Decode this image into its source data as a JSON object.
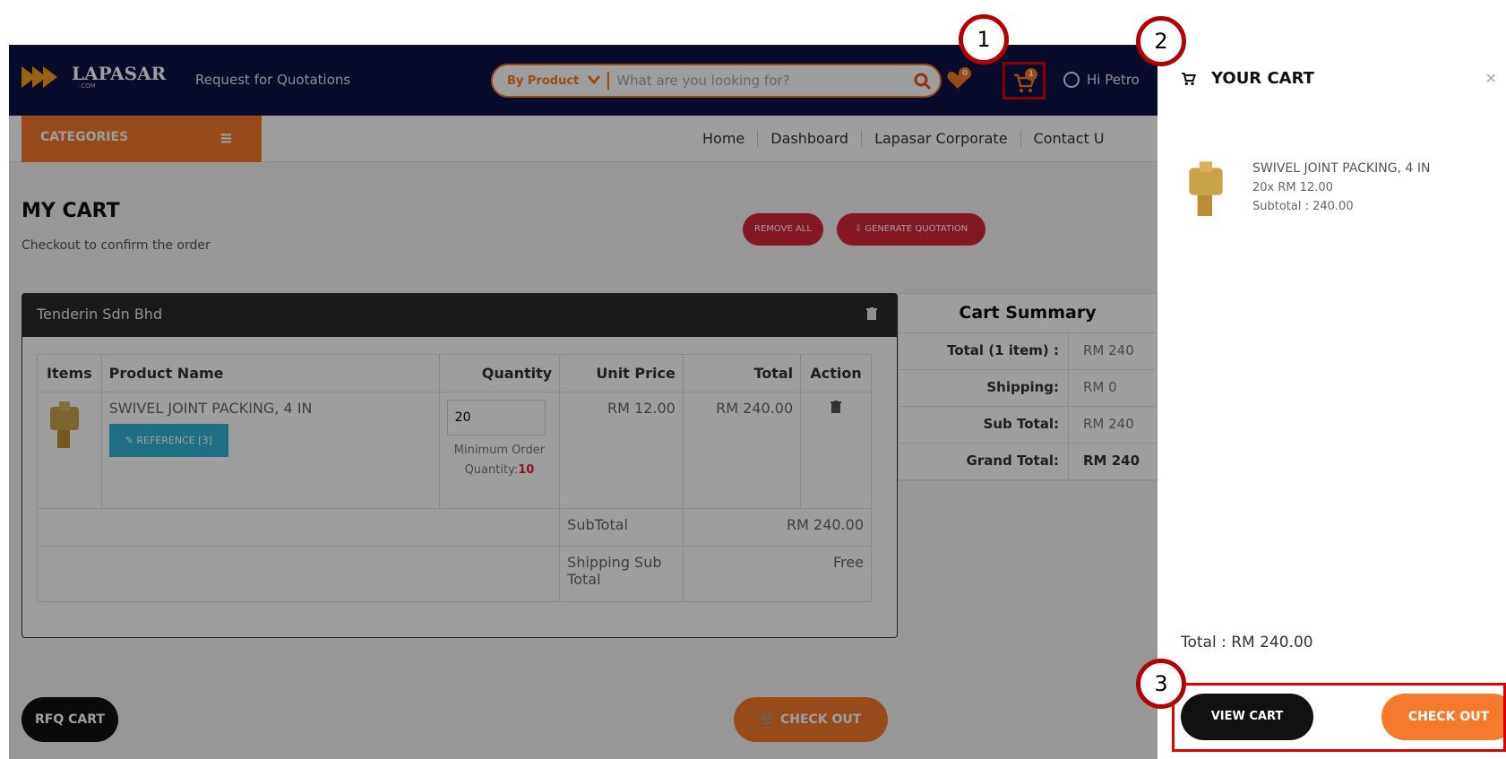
{
  "header": {
    "logo_text": "LAPASAR",
    "logo_sub": ".COM",
    "rfq_link": "Request for Quotations",
    "search": {
      "category": "By Product",
      "placeholder": "What are you looking for?"
    },
    "wishlist_count": "0",
    "cart_count": "1",
    "user_greeting": "Hi Petro"
  },
  "nav": {
    "categories_label": "CATEGORIES",
    "links": [
      "Home",
      "Dashboard",
      "Lapasar Corporate",
      "Contact U"
    ]
  },
  "page": {
    "title": "MY CART",
    "subtitle": "Checkout to confirm the order",
    "remove_all": "REMOVE ALL",
    "generate_quotation": "GENERATE QUOTATION"
  },
  "vendor": {
    "name": "Tenderin Sdn Bhd",
    "columns": [
      "Items",
      "Product Name",
      "Quantity",
      "Unit Price",
      "Total",
      "Action"
    ],
    "item": {
      "name": "SWIVEL JOINT PACKING, 4 IN",
      "reference_label": "REFERENCE [3]",
      "quantity": "20",
      "moq_label": "Minimum Order Quantity:",
      "moq_value": "10",
      "unit_price": "RM 12.00",
      "total": "RM 240.00"
    },
    "subtotal_label": "SubTotal",
    "subtotal_value": "RM 240.00",
    "shipping_label": "Shipping Sub Total",
    "shipping_value": "Free"
  },
  "summary": {
    "title": "Cart Summary",
    "rows": [
      {
        "label": "Total (1 item) :",
        "value": "RM 240"
      },
      {
        "label": "Shipping:",
        "value": "RM 0"
      },
      {
        "label": "Sub Total:",
        "value": "RM 240"
      },
      {
        "label": "Grand Total:",
        "value": "RM 240"
      }
    ]
  },
  "footer": {
    "rfq_cart": "RFQ CART",
    "check_out": "CHECK OUT"
  },
  "drawer": {
    "title": "YOUR CART",
    "item_name": "SWIVEL JOINT PACKING, 4 IN",
    "item_qty": "20x RM 12.00",
    "item_subtotal": "Subtotal : 240.00",
    "total": "Total : RM 240.00",
    "view_cart": "VIEW CART",
    "check_out": "CHECK OUT"
  },
  "callouts": [
    "1",
    "2",
    "3"
  ],
  "colors": {
    "navy": "#0f1244",
    "orange": "#f47a2d",
    "red": "#d7263d",
    "highlight": "#e00000"
  }
}
